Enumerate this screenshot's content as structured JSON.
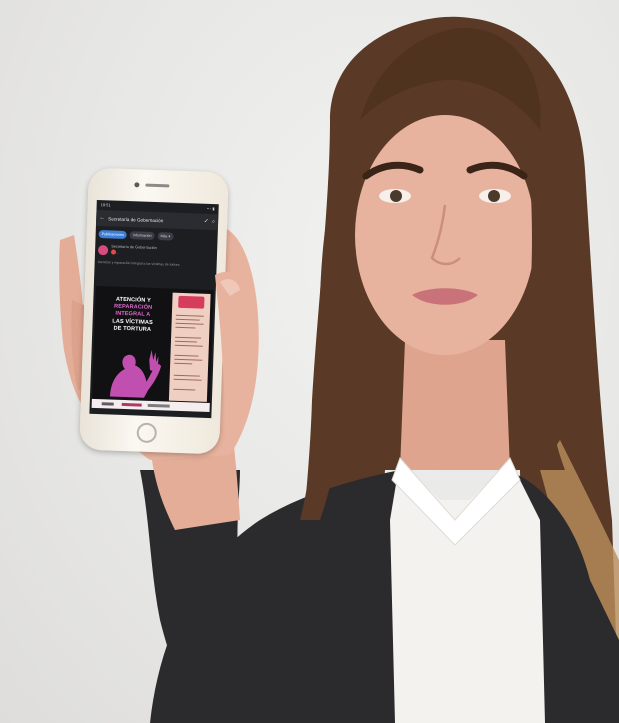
{
  "scene": {
    "colors": {
      "background": "#e7e7e5",
      "hair": "#5a3a26",
      "hair_tips": "#c9a06a",
      "skin": "#e8b39e",
      "jacket": "#2b2b2e",
      "shirt": "#f4f2ef",
      "lips": "#c9727a"
    }
  },
  "phone": {
    "status": {
      "time": "19:51",
      "icons": "▪ ◦ ▮"
    },
    "appbar": {
      "back_icon": "arrow-left-icon",
      "title": "Secretaría de Gobernación",
      "verified_icon": "verified-badge-icon",
      "search_icon": "search-icon"
    },
    "chips": [
      "Publicaciones",
      "Información",
      "Más ▾"
    ],
    "post": {
      "author": "Secretaría de Gobernación",
      "meta": "·"
    },
    "description": "Atención y reparación integral a las víctimas de tortura",
    "poster": {
      "line1": "ATENCIÓN Y",
      "line2": "REPARACIÓN",
      "line3": "INTEGRAL A",
      "line4": "LAS VÍCTIMAS",
      "line5": "DE TORTURA",
      "colors": {
        "pink": "#e16ad0",
        "figure": "#c14fb0",
        "side_panel": "#f0cfc3"
      }
    }
  }
}
